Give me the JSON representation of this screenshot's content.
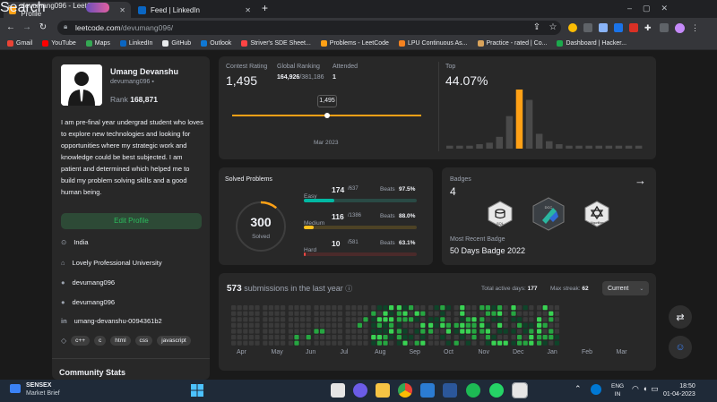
{
  "browser": {
    "tabs": [
      {
        "title": "devumang096 - LeetCode Profile",
        "close": "✕"
      },
      {
        "title": "Feed | LinkedIn",
        "close": "✕"
      }
    ],
    "new_tab": "+",
    "url_host": "leetcode.com",
    "url_path": "/devumang096/",
    "bookmarks": [
      {
        "label": "Gmail",
        "color": "#ea4335"
      },
      {
        "label": "YouTube",
        "color": "#ff0000"
      },
      {
        "label": "Maps",
        "color": "#34a853"
      },
      {
        "label": "LinkedIn",
        "color": "#0a66c2"
      },
      {
        "label": "GitHub",
        "color": "#e8eaed"
      },
      {
        "label": "Outlook",
        "color": "#0f78d4"
      },
      {
        "label": "Striver's SDE Sheet...",
        "color": "#ff4444"
      },
      {
        "label": "Problems - LeetCode",
        "color": "#ffa116"
      },
      {
        "label": "LPU Continuous As...",
        "color": "#f58220"
      },
      {
        "label": "Practice - rated | Co...",
        "color": "#d9a35b"
      },
      {
        "label": "Dashboard | Hacker...",
        "color": "#1ba94c"
      }
    ]
  },
  "profile": {
    "name": "Umang Devanshu",
    "username": "devumang096",
    "rank_label": "Rank",
    "rank_value": "168,871",
    "bio": "I am pre-final year undergrad student who loves to explore new technologies and looking for opportunities where my strategic work and knowledge could be best subjected. I am patient and determined which helped me to build my problem solving skills and a good human being.",
    "edit_button": "Edit Profile",
    "location": "India",
    "school": "Lovely Professional University",
    "github": "devumang096",
    "website": "devumang096",
    "linkedin": "umang-devanshu-0094361b2",
    "skills": [
      "c++",
      "c",
      "html",
      "css",
      "javascript"
    ],
    "community_stats": "Community Stats"
  },
  "contest": {
    "rating_label": "Contest Rating",
    "rating_value": "1,495",
    "global_label": "Global Ranking",
    "global_value": "164,926",
    "global_total": "/381,186",
    "attended_label": "Attended",
    "attended_value": "1",
    "tooltip": "1,495",
    "month": "Mar 2023",
    "top_label": "Top",
    "top_value": "44.07%",
    "histogram": [
      2,
      2,
      2,
      3,
      4,
      8,
      22,
      40,
      33,
      10,
      5,
      3,
      2,
      2,
      2,
      2,
      2,
      2,
      2,
      2
    ],
    "histogram_highlight_index": 7
  },
  "solved": {
    "title": "Solved Problems",
    "total": "300",
    "total_label": "Solved",
    "progress_fraction": 0.11,
    "rows": [
      {
        "name": "Easy",
        "count": "174",
        "total": "/637",
        "beats_label": "Beats",
        "beats": "97.5%",
        "fraction": 0.273,
        "color": "#00b8a3",
        "track": "#2a4a45"
      },
      {
        "name": "Medium",
        "count": "116",
        "total": "/1386",
        "beats_label": "Beats",
        "beats": "88.0%",
        "fraction": 0.084,
        "color": "#ffc01e",
        "track": "#4d4225"
      },
      {
        "name": "Hard",
        "count": "10",
        "total": "/581",
        "beats_label": "Beats",
        "beats": "63.1%",
        "fraction": 0.017,
        "color": "#ef4743",
        "track": "#4a2a2a"
      }
    ]
  },
  "badges": {
    "title": "Badges",
    "count": "4",
    "recent_label": "Most Recent Badge",
    "recent_name": "50 Days Badge 2022",
    "items": [
      {
        "label": "SQL"
      },
      {
        "label": "DCC"
      },
      {
        "label": "Algorithm"
      }
    ]
  },
  "submissions": {
    "count": "573",
    "text": "submissions in the last year",
    "active_label": "Total active days:",
    "active_value": "177",
    "streak_label": "Max streak:",
    "streak_value": "62",
    "dropdown": "Current",
    "months": [
      "Apr",
      "May",
      "Jun",
      "Jul",
      "Aug",
      "Sep",
      "Oct",
      "Nov",
      "Dec",
      "Jan",
      "Feb",
      "Mar"
    ]
  },
  "taskbar": {
    "weather_title": "SENSEX",
    "weather_sub": "Market Brief",
    "search": "Search",
    "lang_1": "ENG",
    "lang_2": "IN",
    "time": "18:50",
    "date": "01-04-2023"
  },
  "colors": {
    "accent": "#ffa116",
    "green_dark": "#0e4429",
    "green_mid": "#26a641",
    "green_light": "#39d353",
    "empty": "#3a3a3a",
    "edit_btn_bg": "#2d4a36",
    "edit_btn_text": "#2cbb5d"
  }
}
